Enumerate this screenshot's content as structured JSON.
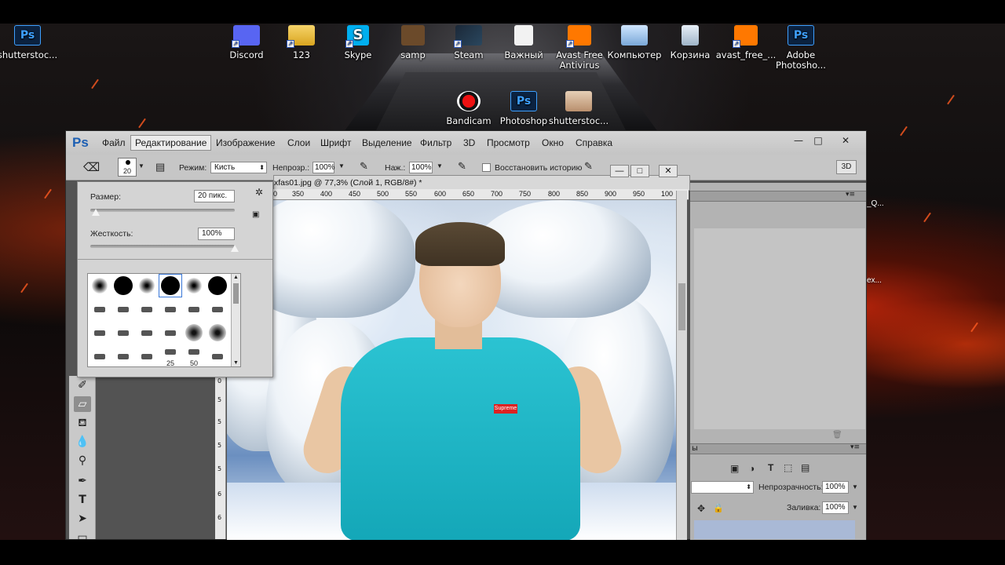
{
  "desktop": {
    "icons": [
      {
        "label": "shutterstoc...",
        "icon": "photoshop-icon"
      },
      {
        "label": "Discord",
        "icon": "discord-icon"
      },
      {
        "label": "123",
        "icon": "folder-icon"
      },
      {
        "label": "Skype",
        "icon": "skype-icon"
      },
      {
        "label": "samp",
        "icon": "samp-icon"
      },
      {
        "label": "Steam",
        "icon": "steam-icon"
      },
      {
        "label": "Важный",
        "icon": "document-icon"
      },
      {
        "label": "Avast Free Antivirus",
        "icon": "avast-icon"
      },
      {
        "label": "Компьютер",
        "icon": "computer-icon"
      },
      {
        "label": "Корзина",
        "icon": "recycle-bin-icon"
      },
      {
        "label": "avast_free_...",
        "icon": "avast-installer-icon"
      },
      {
        "label": "Adobe Photosho...",
        "icon": "photoshop-icon"
      }
    ],
    "center_icons": [
      {
        "label": "Bandicam",
        "icon": "bandicam-icon"
      },
      {
        "label": "Photoshop",
        "icon": "photoshop-icon"
      },
      {
        "label": "shutterstoc...",
        "icon": "photo-thumbnail-icon"
      }
    ],
    "right_edge_texts": [
      "_Q...",
      "ex..."
    ]
  },
  "photoshop": {
    "logo": "Ps",
    "menu": [
      "Файл",
      "Редактирование",
      "Изображение",
      "Слои",
      "Шрифт",
      "Выделение",
      "Фильтр",
      "3D",
      "Просмотр",
      "Окно",
      "Справка"
    ],
    "active_menu_index": 1,
    "window_buttons": {
      "minimize": "—",
      "maximize": "□",
      "close": "✕"
    },
    "options": {
      "brush_size": "20",
      "mode_label": "Режим:",
      "mode_value": "Кисть",
      "opacity_label": "Непрозр.:",
      "opacity_value": "100%",
      "flow_label": "Наж.:",
      "flow_value": "100%",
      "restore_history_label": "Восстановить историю",
      "btn_3d": "3D"
    },
    "brush_popup": {
      "size_label": "Размер:",
      "size_value": "20 пикс.",
      "size_fraction": 0.04,
      "hardness_label": "Жесткость:",
      "hardness_value": "100%",
      "hardness_fraction": 1.0,
      "preset_labels": [
        "25",
        "50"
      ]
    },
    "document": {
      "title": "xfas01.jpg @ 77,3% (Слой 1, RGB/8#) *",
      "ruler_top": [
        "0",
        "350",
        "400",
        "450",
        "500",
        "550",
        "600",
        "650",
        "700",
        "750",
        "800",
        "850",
        "900",
        "950",
        "100"
      ],
      "ruler_left": [
        "0",
        "5",
        "5",
        "5",
        "5",
        "6",
        "6"
      ],
      "shirt_logo": "Supreme"
    },
    "right_panels": {
      "opacity_label": "Непрозрачность:",
      "opacity_value": "100%",
      "fill_label": "Заливка:",
      "fill_value": "100%",
      "panel_tab_text": "ы"
    }
  }
}
